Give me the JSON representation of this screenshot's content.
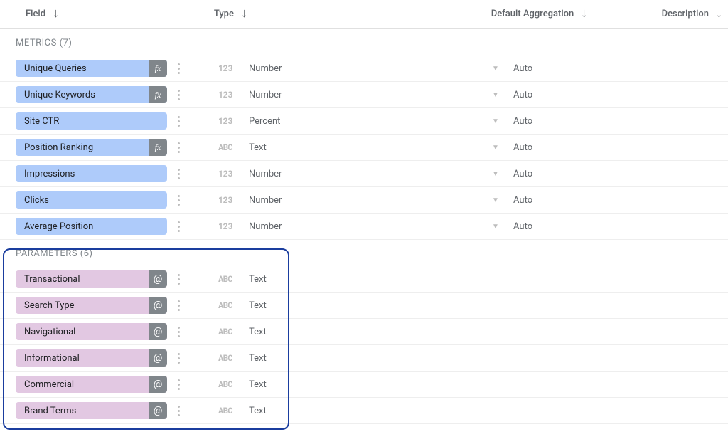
{
  "columns": {
    "field": "Field",
    "type": "Type",
    "aggregation": "Default Aggregation",
    "description": "Description"
  },
  "sections": [
    {
      "title": "METRICS (7)",
      "kind": "metric",
      "rows": [
        {
          "name": "Unique Queries",
          "badge": "fx",
          "typeIcon": "123",
          "typeLabel": "Number",
          "agg": "Auto"
        },
        {
          "name": "Unique Keywords",
          "badge": "fx",
          "typeIcon": "123",
          "typeLabel": "Number",
          "agg": "Auto"
        },
        {
          "name": "Site CTR",
          "badge": "",
          "typeIcon": "123",
          "typeLabel": "Percent",
          "agg": "Auto"
        },
        {
          "name": "Position Ranking",
          "badge": "fx",
          "typeIcon": "ABC",
          "typeLabel": "Text",
          "agg": "Auto"
        },
        {
          "name": "Impressions",
          "badge": "",
          "typeIcon": "123",
          "typeLabel": "Number",
          "agg": "Auto"
        },
        {
          "name": "Clicks",
          "badge": "",
          "typeIcon": "123",
          "typeLabel": "Number",
          "agg": "Auto"
        },
        {
          "name": "Average Position",
          "badge": "",
          "typeIcon": "123",
          "typeLabel": "Number",
          "agg": "Auto"
        }
      ]
    },
    {
      "title": "PARAMETERS (6)",
      "kind": "parameter",
      "rows": [
        {
          "name": "Transactional",
          "badge": "@",
          "typeIcon": "ABC",
          "typeLabel": "Text",
          "agg": ""
        },
        {
          "name": "Search Type",
          "badge": "@",
          "typeIcon": "ABC",
          "typeLabel": "Text",
          "agg": ""
        },
        {
          "name": "Navigational",
          "badge": "@",
          "typeIcon": "ABC",
          "typeLabel": "Text",
          "agg": ""
        },
        {
          "name": "Informational",
          "badge": "@",
          "typeIcon": "ABC",
          "typeLabel": "Text",
          "agg": ""
        },
        {
          "name": "Commercial",
          "badge": "@",
          "typeIcon": "ABC",
          "typeLabel": "Text",
          "agg": ""
        },
        {
          "name": "Brand Terms",
          "badge": "@",
          "typeIcon": "ABC",
          "typeLabel": "Text",
          "agg": ""
        }
      ]
    }
  ]
}
